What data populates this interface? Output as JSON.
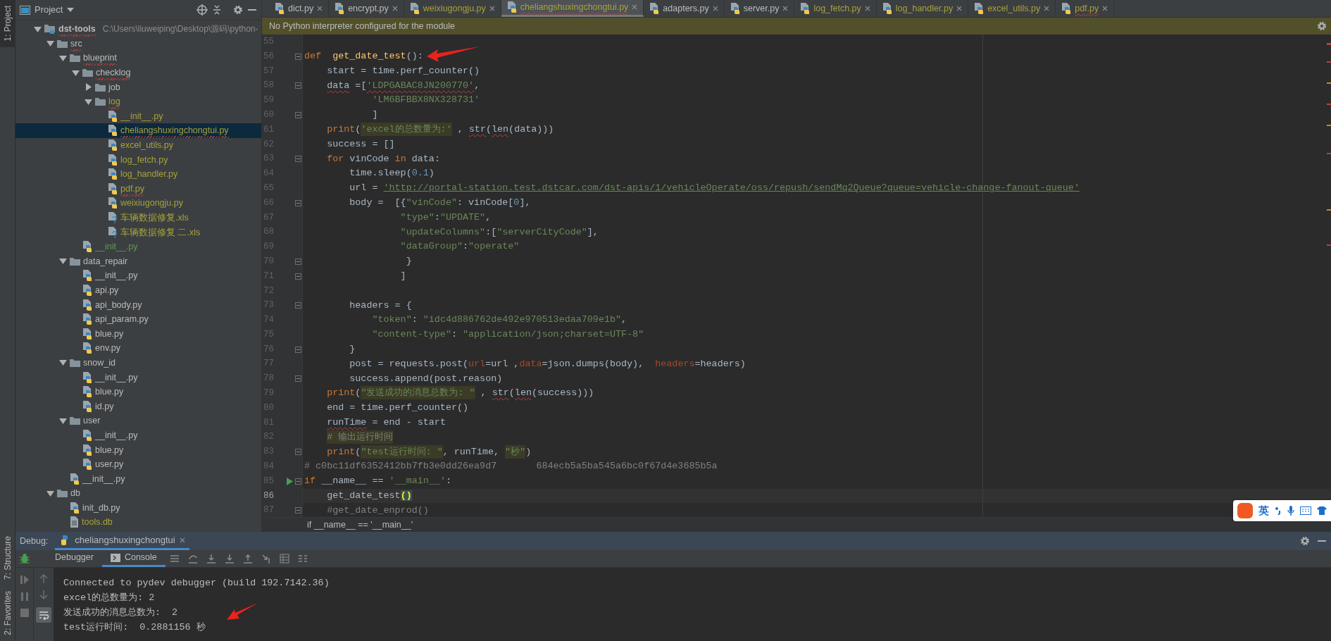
{
  "tool_stripe": [
    {
      "label": "1: Project",
      "selected": true
    },
    {
      "label": "7: Structure",
      "selected": false
    },
    {
      "label": "2: Favorites",
      "selected": false
    }
  ],
  "project_panel": {
    "title": "Project",
    "tree": [
      {
        "label": "dst-tools",
        "kind": "project",
        "path": "C:\\Users\\liuweiping\\Desktop\\源码\\python-",
        "expanded": true,
        "selected": false,
        "typo": true,
        "children": [
          {
            "label": "src",
            "kind": "folder",
            "expanded": true,
            "selected": false,
            "typo": true,
            "children": [
              {
                "label": "blueprint",
                "kind": "folder",
                "expanded": true,
                "selected": false,
                "typo": true,
                "children": [
                  {
                    "label": "checklog",
                    "kind": "folder",
                    "expanded": true,
                    "selected": false,
                    "typo": true,
                    "children": [
                      {
                        "label": "job",
                        "kind": "folder",
                        "expanded": false,
                        "selected": false
                      },
                      {
                        "label": "log",
                        "kind": "folder",
                        "expanded": true,
                        "selected": false,
                        "color": "#a6a23b",
                        "typo": true,
                        "children": [
                          {
                            "label": "__init__.py",
                            "kind": "python",
                            "selected": false,
                            "color": "#a6a23b"
                          },
                          {
                            "label": "cheliangshuxingchongtui.py",
                            "kind": "python",
                            "selected": true,
                            "color": "#a6a23b",
                            "typo": true
                          },
                          {
                            "label": "excel_utils.py",
                            "kind": "python",
                            "selected": false,
                            "color": "#a6a23b"
                          },
                          {
                            "label": "log_fetch.py",
                            "kind": "python",
                            "selected": false,
                            "color": "#a6a23b"
                          },
                          {
                            "label": "log_handler.py",
                            "kind": "python",
                            "selected": false,
                            "color": "#a6a23b"
                          },
                          {
                            "label": "pdf.py",
                            "kind": "python",
                            "selected": false,
                            "color": "#a6a23b",
                            "typo": true
                          },
                          {
                            "label": "weixiugongju.py",
                            "kind": "python",
                            "selected": false,
                            "color": "#a6a23b"
                          },
                          {
                            "label": "车辆数据修复.xls",
                            "kind": "unknown",
                            "selected": false,
                            "color": "#a6a23b"
                          },
                          {
                            "label": "车辆数据修复 二.xls",
                            "kind": "unknown",
                            "selected": false,
                            "color": "#a6a23b"
                          }
                        ]
                      }
                    ]
                  },
                  {
                    "label": "__init__.py",
                    "kind": "python",
                    "selected": false,
                    "color": "#629755"
                  }
                ]
              },
              {
                "label": "data_repair",
                "kind": "folder",
                "expanded": true,
                "selected": false,
                "children": [
                  {
                    "label": "__init__.py",
                    "kind": "python",
                    "selected": false
                  },
                  {
                    "label": "api.py",
                    "kind": "python",
                    "selected": false
                  },
                  {
                    "label": "api_body.py",
                    "kind": "python",
                    "selected": false
                  },
                  {
                    "label": "api_param.py",
                    "kind": "python",
                    "selected": false
                  },
                  {
                    "label": "blue.py",
                    "kind": "python",
                    "selected": false
                  },
                  {
                    "label": "env.py",
                    "kind": "python",
                    "selected": false
                  }
                ]
              },
              {
                "label": "snow_id",
                "kind": "folder",
                "expanded": true,
                "selected": false,
                "children": [
                  {
                    "label": "__init__.py",
                    "kind": "python",
                    "selected": false
                  },
                  {
                    "label": "blue.py",
                    "kind": "python",
                    "selected": false
                  },
                  {
                    "label": "id.py",
                    "kind": "python",
                    "selected": false
                  }
                ]
              },
              {
                "label": "user",
                "kind": "folder",
                "expanded": true,
                "selected": false,
                "children": [
                  {
                    "label": "__init__.py",
                    "kind": "python",
                    "selected": false
                  },
                  {
                    "label": "blue.py",
                    "kind": "python",
                    "selected": false
                  },
                  {
                    "label": "user.py",
                    "kind": "python",
                    "selected": false
                  }
                ]
              },
              {
                "label": "__init__.py",
                "kind": "python",
                "selected": false
              }
            ]
          },
          {
            "label": "db",
            "kind": "folder",
            "expanded": true,
            "selected": false,
            "children": [
              {
                "label": "init_db.py",
                "kind": "python",
                "selected": false
              },
              {
                "label": "tools.db",
                "kind": "text",
                "selected": false,
                "color": "#a6a23b"
              }
            ]
          }
        ]
      }
    ]
  },
  "editor_tabs": [
    {
      "label": "dict.py",
      "selected": false
    },
    {
      "label": "encrypt.py",
      "selected": false
    },
    {
      "label": "weixiugongju.py",
      "selected": false,
      "color": "#a6a23b"
    },
    {
      "label": "cheliangshuxingchongtui.py",
      "selected": true,
      "color": "#a6a23b",
      "typo": true
    },
    {
      "label": "adapters.py",
      "selected": false
    },
    {
      "label": "server.py",
      "selected": false
    },
    {
      "label": "log_fetch.py",
      "selected": false,
      "color": "#a6a23b"
    },
    {
      "label": "log_handler.py",
      "selected": false,
      "color": "#a6a23b"
    },
    {
      "label": "excel_utils.py",
      "selected": false,
      "color": "#a6a23b"
    },
    {
      "label": "pdf.py",
      "selected": false,
      "color": "#a6a23b",
      "typo": true
    }
  ],
  "notification": "No Python interpreter configured for the module",
  "lines": [
    {
      "number": "55",
      "fold": false,
      "current": false
    },
    {
      "number": "56",
      "fold": true,
      "current": false,
      "tokens": [
        {
          "text": "def",
          "kind": "kw"
        },
        {
          "text": "  get_date_test",
          "kind": "fn"
        },
        {
          "text": "():"
        }
      ]
    },
    {
      "number": "57",
      "fold": false,
      "current": false,
      "tokens": [
        {
          "text": "    start = time.perf_counter()"
        }
      ]
    },
    {
      "number": "58",
      "fold": true,
      "current": false,
      "tokens": [
        {
          "text": "    data",
          "typo": true
        },
        {
          "text": " =["
        },
        {
          "text": "'LDPGABAC8JN200770'",
          "kind": "str",
          "typo": true
        },
        {
          "text": ","
        }
      ]
    },
    {
      "number": "59",
      "fold": false,
      "current": false,
      "tokens": [
        {
          "text": "            'LM6BFBBX8NX328731'",
          "kind": "str"
        }
      ]
    },
    {
      "number": "60",
      "fold": true,
      "current": false,
      "tokens": [
        {
          "text": "            ]"
        }
      ]
    },
    {
      "number": "61",
      "fold": false,
      "current": false,
      "tokens": [
        {
          "text": "    print",
          "kind": "kw"
        },
        {
          "text": "("
        },
        {
          "text": "'excel的总数量为:'",
          "kind": "hl"
        },
        {
          "text": " ,"
        },
        {
          "text": " str",
          "typo": true
        },
        {
          "text": "("
        },
        {
          "text": "len",
          "typo": true
        },
        {
          "text": "(data)))"
        }
      ]
    },
    {
      "number": "62",
      "fold": false,
      "current": false,
      "tokens": [
        {
          "text": "    success = []"
        }
      ]
    },
    {
      "number": "63",
      "fold": true,
      "current": false,
      "tokens": [
        {
          "text": "    for",
          "kind": "kw"
        },
        {
          "text": " vinCode"
        },
        {
          "text": " in",
          "kind": "kw"
        },
        {
          "text": " data:"
        }
      ]
    },
    {
      "number": "64",
      "fold": false,
      "current": false,
      "tokens": [
        {
          "text": "        time.sleep("
        },
        {
          "text": "0.1",
          "kind": "num"
        },
        {
          "text": ")"
        }
      ]
    },
    {
      "number": "65",
      "fold": false,
      "current": false,
      "tokens": [
        {
          "text": "        url ="
        },
        {
          "text": " 'http://portal-station.test.dstcar.com/dst-apis/1/vehicleOperate/oss/repush/sendMq2Queue?queue=vehicle-change-fanout-queue'",
          "kind": "link"
        }
      ]
    },
    {
      "number": "66",
      "fold": true,
      "current": false,
      "tokens": [
        {
          "text": "        body =  [{"
        },
        {
          "text": "\"vinCode\"",
          "kind": "str"
        },
        {
          "text": ": vinCode["
        },
        {
          "text": "0",
          "kind": "num"
        },
        {
          "text": "],"
        }
      ]
    },
    {
      "number": "67",
      "fold": false,
      "current": false,
      "tokens": [
        {
          "text": "                 \"type\"",
          "kind": "str"
        },
        {
          "text": ":"
        },
        {
          "text": "\"UPDATE\"",
          "kind": "str"
        },
        {
          "text": ","
        }
      ]
    },
    {
      "number": "68",
      "fold": false,
      "current": false,
      "tokens": [
        {
          "text": "                 \"updateColumns\"",
          "kind": "str"
        },
        {
          "text": ":["
        },
        {
          "text": "\"serverCityCode\"",
          "kind": "str"
        },
        {
          "text": "],"
        }
      ]
    },
    {
      "number": "69",
      "fold": false,
      "current": false,
      "tokens": [
        {
          "text": "                 \"dataGroup\"",
          "kind": "str"
        },
        {
          "text": ":"
        },
        {
          "text": "\"operate\"",
          "kind": "str"
        }
      ]
    },
    {
      "number": "70",
      "fold": true,
      "current": false,
      "tokens": [
        {
          "text": "                  }"
        }
      ]
    },
    {
      "number": "71",
      "fold": true,
      "current": false,
      "tokens": [
        {
          "text": "                 ]"
        }
      ]
    },
    {
      "number": "72",
      "fold": false,
      "current": false
    },
    {
      "number": "73",
      "fold": true,
      "current": false,
      "tokens": [
        {
          "text": "        headers = {"
        }
      ]
    },
    {
      "number": "74",
      "fold": false,
      "current": false,
      "tokens": [
        {
          "text": "            \"token\"",
          "kind": "str"
        },
        {
          "text": ":"
        },
        {
          "text": " \"idc4d886762de492e970513edaa709e1b\"",
          "kind": "str"
        },
        {
          "text": ","
        }
      ]
    },
    {
      "number": "75",
      "fold": false,
      "current": false,
      "tokens": [
        {
          "text": "            \"content-type\"",
          "kind": "str"
        },
        {
          "text": ":"
        },
        {
          "text": " \"application/json;charset=UTF-8\"",
          "kind": "str"
        }
      ]
    },
    {
      "number": "76",
      "fold": true,
      "current": false,
      "tokens": [
        {
          "text": "        }"
        }
      ]
    },
    {
      "number": "77",
      "fold": false,
      "current": false,
      "tokens": [
        {
          "text": "        post = requests.post("
        },
        {
          "text": "url",
          "kind": "param"
        },
        {
          "text": "=url ,"
        },
        {
          "text": "data",
          "kind": "param"
        },
        {
          "text": "=json.dumps(body),"
        },
        {
          "text": "  headers",
          "kind": "param"
        },
        {
          "text": "=headers)"
        }
      ]
    },
    {
      "number": "78",
      "fold": true,
      "current": false,
      "tokens": [
        {
          "text": "        success.append(post.reason)"
        }
      ]
    },
    {
      "number": "79",
      "fold": false,
      "current": false,
      "tokens": [
        {
          "text": "    print",
          "kind": "kw"
        },
        {
          "text": "("
        },
        {
          "text": "\"发送成功的消息总数为: \"",
          "kind": "hl"
        },
        {
          "text": " ,"
        },
        {
          "text": " str",
          "typo": true
        },
        {
          "text": "("
        },
        {
          "text": "len",
          "typo": true
        },
        {
          "text": "(success)))"
        }
      ]
    },
    {
      "number": "80",
      "fold": false,
      "current": false,
      "tokens": [
        {
          "text": "    end = time.perf_counter()"
        }
      ]
    },
    {
      "number": "81",
      "fold": false,
      "current": false,
      "tokens": [
        {
          "text": "    runTime",
          "typo": true
        },
        {
          "text": " = end - start"
        }
      ]
    },
    {
      "number": "82",
      "fold": false,
      "current": false,
      "tokens": [
        {
          "text": "    # 输出运行时间",
          "kind": "hlcm"
        }
      ]
    },
    {
      "number": "83",
      "fold": true,
      "current": false,
      "tokens": [
        {
          "text": "    print",
          "kind": "kw"
        },
        {
          "text": "("
        },
        {
          "text": "\"test运行时间: \"",
          "kind": "hl"
        },
        {
          "text": ", runTime,"
        },
        {
          "text": " \"秒\"",
          "kind": "hl"
        },
        {
          "text": ")"
        }
      ]
    },
    {
      "number": "84",
      "fold": false,
      "current": false,
      "tokens": [
        {
          "text": "# c0bc11df6352412bb7fb3e0dd26ea9d7       684ecb5a5ba545a6bc0f67d4e3685b5a",
          "kind": "cm"
        }
      ]
    },
    {
      "number": "85",
      "fold": true,
      "run": true,
      "current": false,
      "tokens": [
        {
          "text": "if",
          "kind": "kw"
        },
        {
          "text": " __name__ =="
        },
        {
          "text": " '__main__'",
          "kind": "str"
        },
        {
          "text": ":"
        }
      ]
    },
    {
      "number": "86",
      "fold": false,
      "current": true,
      "tokens": [
        {
          "text": "    get_date_test"
        },
        {
          "text": "()",
          "kind": "brace"
        }
      ]
    },
    {
      "number": "87",
      "fold": true,
      "current": false,
      "tokens": [
        {
          "text": "    #get_date_enprod()",
          "kind": "cm"
        }
      ]
    }
  ],
  "breadcrumb": "if __name__ == '__main__'",
  "ime_bar": {
    "mode": "英"
  },
  "debug_panel": {
    "title": "Debug:",
    "tab": {
      "label": "cheliangshuxingchongtui",
      "selected": true
    },
    "subtabs": [
      {
        "label": "Debugger",
        "selected": false
      },
      {
        "label": "Console",
        "selected": true
      }
    ],
    "console": [
      "Connected to pydev debugger (build 192.7142.36)",
      "excel的总数量为: 2",
      "发送成功的消息总数为:  2",
      "test运行时间:  0.2881156 秒"
    ]
  }
}
